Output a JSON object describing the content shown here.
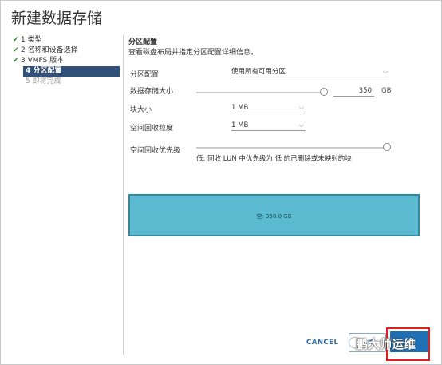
{
  "dialog": {
    "title": "新建数据存储"
  },
  "steps": [
    {
      "num": "1",
      "label": "类型",
      "state": "done"
    },
    {
      "num": "2",
      "label": "名称和设备选择",
      "state": "done"
    },
    {
      "num": "3",
      "label": "VMFS 版本",
      "state": "done"
    },
    {
      "num": "4",
      "label": "分区配置",
      "state": "current"
    },
    {
      "num": "5",
      "label": "即将完成",
      "state": "future"
    }
  ],
  "section": {
    "title": "分区配置",
    "description": "查看磁盘布局并指定分区配置详细信息。"
  },
  "form": {
    "partition_config": {
      "label": "分区配置",
      "value": "使用所有可用分区"
    },
    "datastore_size": {
      "label": "数据存储大小",
      "value": "350",
      "unit": "GB",
      "slider_fraction": 1.0
    },
    "block_size": {
      "label": "块大小",
      "value": "1 MB"
    },
    "reclaim_granularity": {
      "label": "空间回收粒度",
      "value": "1 MB"
    },
    "reclaim_priority": {
      "label": "空间回收优先级",
      "hint": "低: 回收 LUN 中优先级为 低 的已删除或未映射的块",
      "slider_fraction": 1.0
    }
  },
  "disk_layout": {
    "label": "空: 350.0 GB"
  },
  "footer": {
    "cancel_label": "CANCEL",
    "next_label": "K"
  },
  "watermark": {
    "text": "鹏大师运维"
  },
  "colors": {
    "accent": "#1e6fb3",
    "current_step_bg": "#31507a",
    "disk_bar": "#5bbad0",
    "highlight_box": "#e02020"
  }
}
